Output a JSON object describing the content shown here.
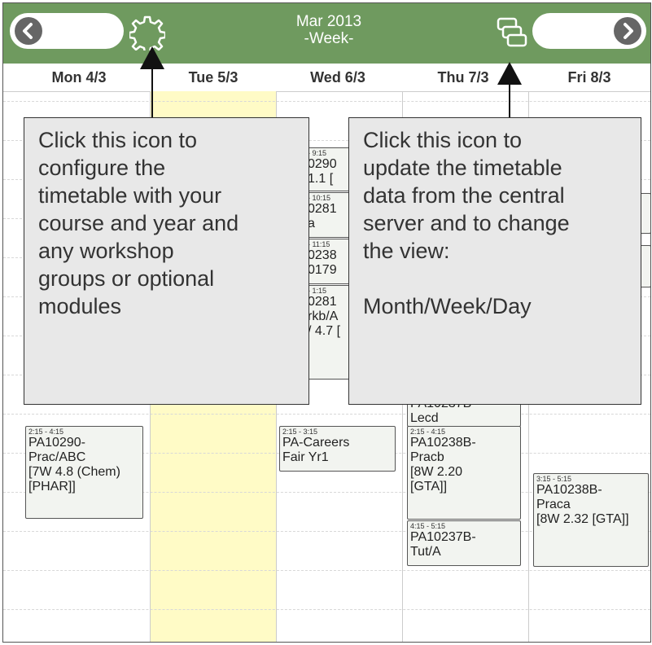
{
  "header": {
    "month": "Mar 2013",
    "view": "-Week-"
  },
  "icons": {
    "prev": "chevron-left-icon",
    "next": "chevron-right-icon",
    "settings": "gear-icon",
    "sync": "stacked-windows-icon"
  },
  "colors": {
    "header": "#6f9a5f",
    "today": "#fffbc6",
    "event_bg": "#f2f4f0"
  },
  "days": [
    {
      "label": "Mon 4/3"
    },
    {
      "label": "Tue 5/3"
    },
    {
      "label": "Wed 6/3"
    },
    {
      "label": "Thu 7/3"
    },
    {
      "label": "Fri 8/3"
    }
  ],
  "events": {
    "wed_1": {
      "time": "- 9:15",
      "text": "0290\n1.1 ["
    },
    "wed_2": {
      "time": "- 10:15",
      "text": "0281\na"
    },
    "wed_3": {
      "time": "- 11:15",
      "text": "0238\n0179"
    },
    "wed_4": {
      "time": "- 1:15",
      "text": "0281\nrkb/A\n/ 4.7 ["
    },
    "thu_1": {
      "time": "",
      "text": "PA10237B-\nLecd"
    },
    "mon_1": {
      "time": "2:15 - 4:15",
      "text": "PA10290-\nPrac/ABC\n[7W 4.8 (Chem)\n[PHAR]]"
    },
    "wed_5": {
      "time": "2:15 - 3:15",
      "text": "PA-Careers\nFair Yr1"
    },
    "thu_2": {
      "time": "2:15 - 4:15",
      "text": "PA10238B-\nPracb\n[8W 2.20\n[GTA]]"
    },
    "thu_3": {
      "time": "4:15 - 5:15",
      "text": "PA10237B-\nTut/A"
    },
    "fri_1": {
      "time": "3:15 - 5:15",
      "text": "PA10238B-\nPraca\n[8W 2.32 [GTA]]"
    }
  },
  "callouts": {
    "settings": "Click this icon to\nconfigure the\ntimetable with your\ncourse and year and\nany workshop\ngroups or optional\nmodules",
    "sync": "Click this icon to\nupdate the timetable\ndata from the central\nserver and to change\nthe view:\n\nMonth/Week/Day"
  }
}
